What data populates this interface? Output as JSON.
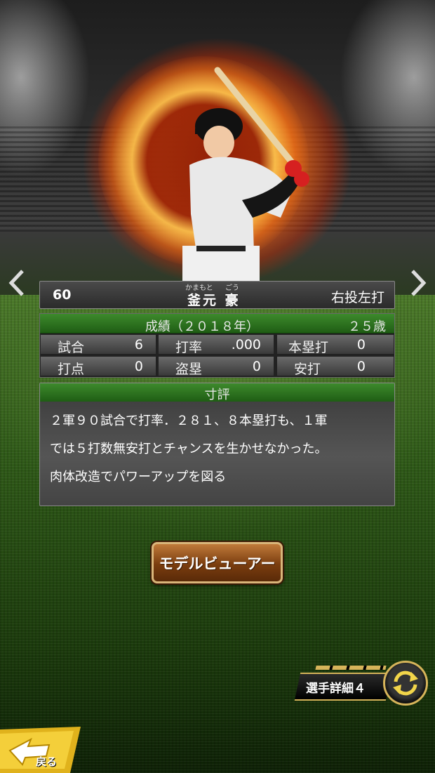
{
  "player": {
    "number": "60",
    "name": "釜元 豪",
    "ruby_given": "かまもと",
    "ruby_family": "ごう",
    "throws_bats": "右投左打"
  },
  "stats": {
    "title": "成績（２０１８年）",
    "age": "２５歳",
    "cells": [
      {
        "label": "試合",
        "value": "6"
      },
      {
        "label": "打率",
        "value": ".000"
      },
      {
        "label": "本塁打",
        "value": "0"
      },
      {
        "label": "打点",
        "value": "0"
      },
      {
        "label": "盗塁",
        "value": "0"
      },
      {
        "label": "安打",
        "value": "0"
      }
    ]
  },
  "review": {
    "title": "寸評",
    "text": "２軍９０試合で打率．２８１、８本塁打も、１軍\nでは５打数無安打とチャンスを生かせなかった。\n肉体改造でパワーアップを図る"
  },
  "buttons": {
    "model_viewer": "モデルビューアー",
    "player_detail": "選手詳細４",
    "back": "戻る"
  },
  "icons": {
    "prev": "chevron-left-icon",
    "next": "chevron-right-icon",
    "swap": "swap-icon",
    "back": "back-arrow-icon"
  },
  "colors": {
    "header_green": "#2f7a22",
    "button_brown": "#7a3d0f",
    "gold": "#d6b45a"
  }
}
